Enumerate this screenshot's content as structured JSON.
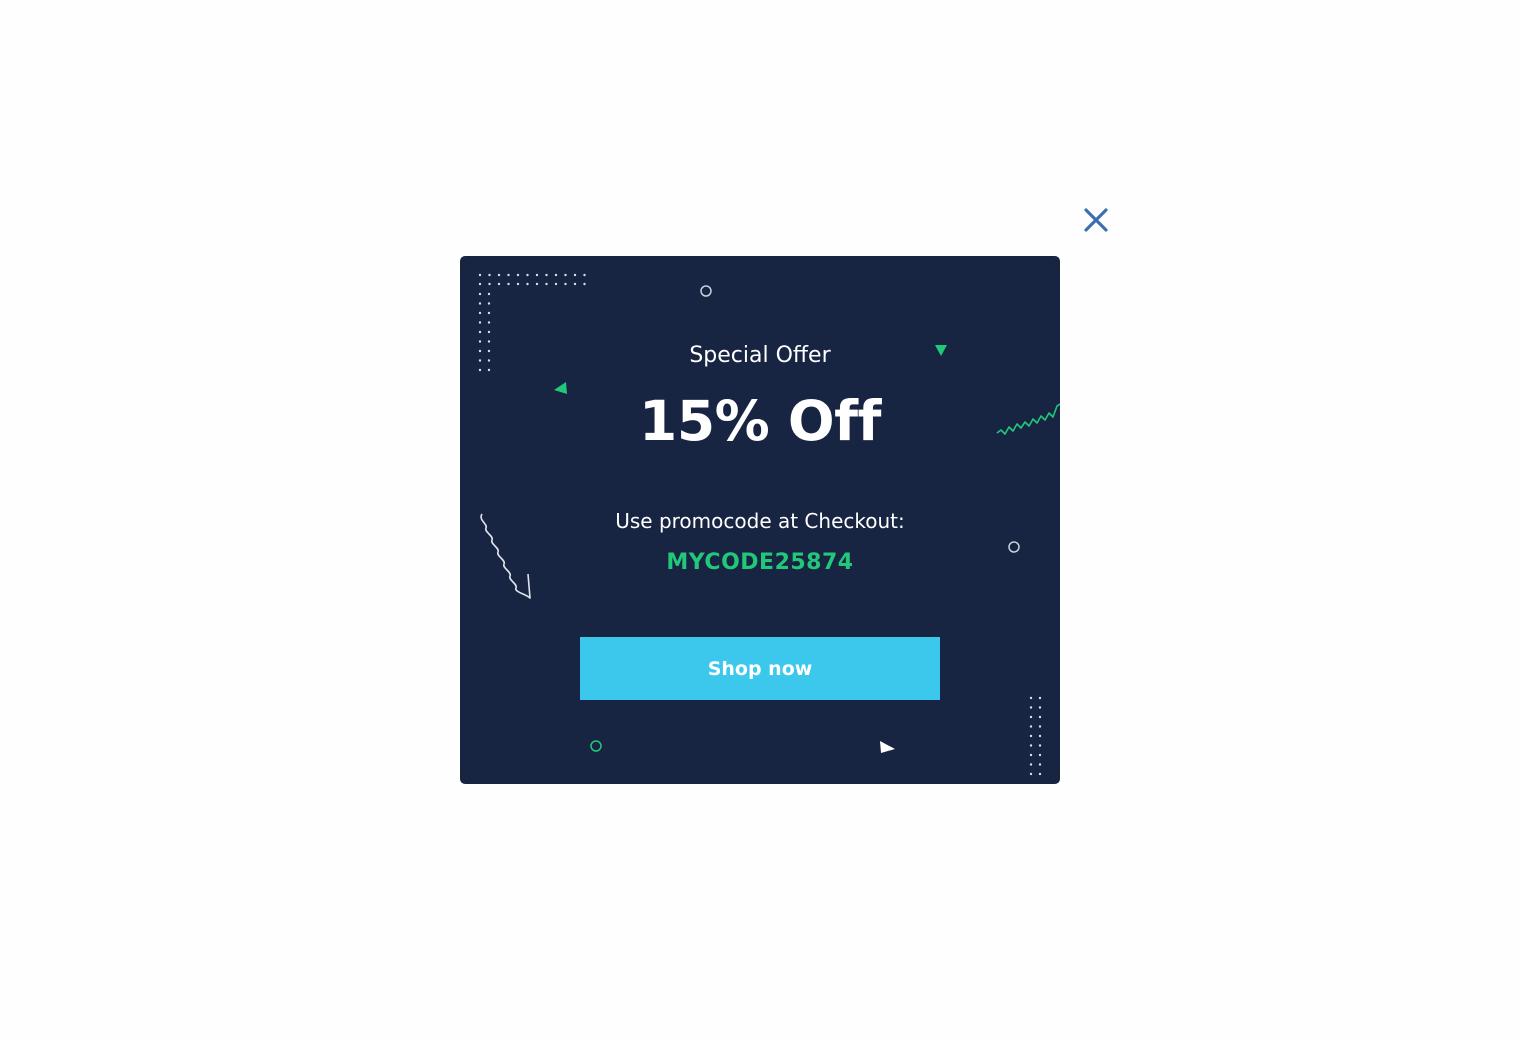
{
  "close_button": {
    "icon": "close-icon",
    "color": "#3d6fb0"
  },
  "popup": {
    "background": "#172442",
    "eyebrow": "Special Offer",
    "headline": "15% Off",
    "instruction": "Use promocode at Checkout:",
    "promo_code": "MYCODE25874",
    "promo_color": "#22c87a",
    "cta_label": "Shop now",
    "cta_color": "#3cc8ec"
  }
}
